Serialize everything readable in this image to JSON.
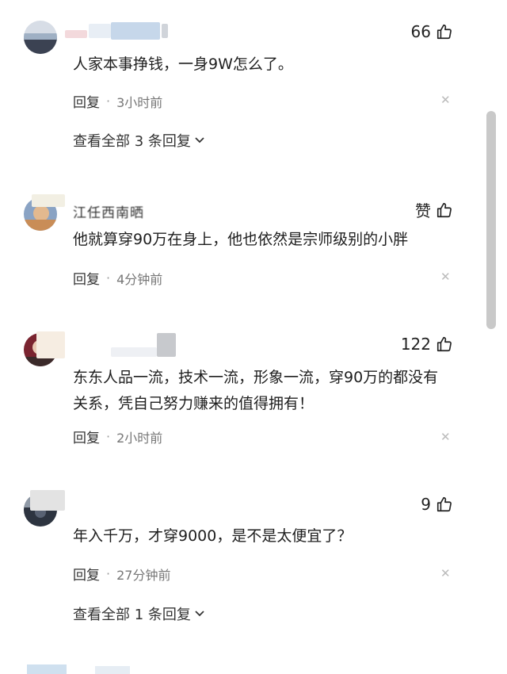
{
  "comments": [
    {
      "likes": "66",
      "content": "人家本事挣钱，一身9W怎么了。",
      "reply_label": "回复",
      "time": "3小时前",
      "view_all": "查看全部 3 条回复"
    },
    {
      "username": "江任西南晒",
      "likes": "赞",
      "content": "他就算穿90万在身上，他也依然是宗师级别的小胖",
      "reply_label": "回复",
      "time": "4分钟前"
    },
    {
      "likes": "122",
      "content": "东东人品一流，技术一流，形象一流，穿90万的都没有关系，凭自己努力赚来的值得拥有！",
      "reply_label": "回复",
      "time": "2小时前"
    },
    {
      "likes": "9",
      "content": "年入千万，才穿9000，是不是太便宜了？",
      "reply_label": "回复",
      "time": "27分钟前",
      "view_all": "查看全部 1 条回复"
    }
  ],
  "icons": {
    "like": "thumbs-up-icon",
    "close": "close-icon",
    "chevron": "chevron-down-icon"
  },
  "colors": {
    "background": "#ffffff",
    "text": "#1e1e1e",
    "meta": "#777777",
    "scrollbar": "#c9c9c9"
  }
}
